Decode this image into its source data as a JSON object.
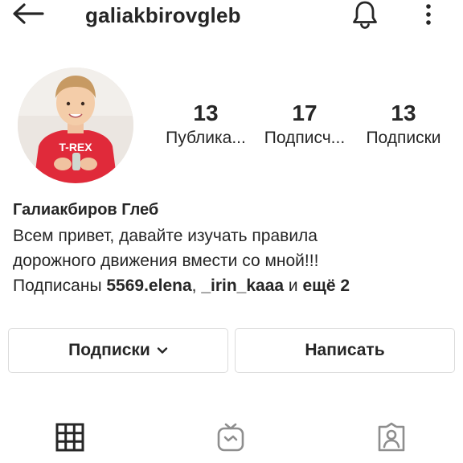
{
  "header": {
    "username": "galiakbirovgleb",
    "back_icon": "arrow-left-icon",
    "bell_icon": "bell-icon",
    "more_icon": "more-vertical-icon"
  },
  "profile": {
    "avatar_icon": "profile-photo",
    "stats": {
      "posts": {
        "count": "13",
        "label": "Публика..."
      },
      "followers": {
        "count": "17",
        "label": "Подписч..."
      },
      "following": {
        "count": "13",
        "label": "Подписки"
      }
    },
    "full_name": "Галиакбиров Глеб",
    "bio_lines": [
      "Всем привет, давайте изучать правила",
      "дорожного движения вмести со мной!!!"
    ],
    "followed_by": {
      "prefix": "Подписаны ",
      "user1": "5569.elena",
      "separator": ", ",
      "user2": "_irin_kaaa",
      "middle": " и ",
      "more": "ещё 2"
    }
  },
  "actions": {
    "following_label": "Подписки",
    "message_label": "Написать"
  },
  "tabs": [
    {
      "name": "grid",
      "icon": "grid-icon"
    },
    {
      "name": "igtv",
      "icon": "igtv-icon"
    },
    {
      "name": "tagged",
      "icon": "tagged-icon"
    }
  ],
  "colors": {
    "text": "#262626",
    "border": "#dbdbdb",
    "background": "#ffffff"
  }
}
